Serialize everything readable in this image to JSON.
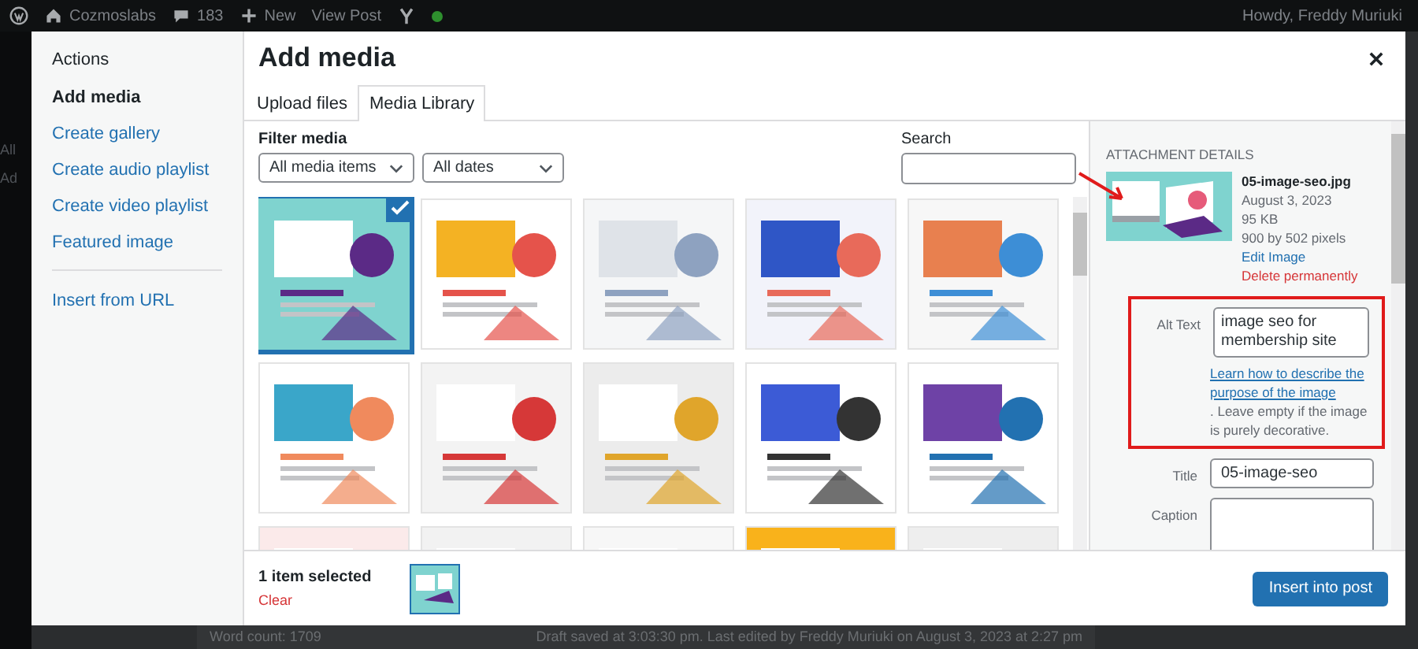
{
  "admin_bar": {
    "site": "Cozmoslabs",
    "comments": "183",
    "new": "New",
    "view_post": "View Post",
    "greeting": "Howdy, Freddy Muriuki"
  },
  "admin_menu": [
    "All",
    "Ad"
  ],
  "modal": {
    "title": "Add media",
    "sidebar": {
      "heading": "Actions",
      "items": [
        {
          "label": "Add media",
          "selected": true
        },
        {
          "label": "Create gallery",
          "selected": false
        },
        {
          "label": "Create audio playlist",
          "selected": false
        },
        {
          "label": "Create video playlist",
          "selected": false
        },
        {
          "label": "Featured image",
          "selected": false
        }
      ],
      "extra_items": [
        {
          "label": "Insert from URL",
          "selected": false
        }
      ]
    },
    "tabs": [
      {
        "label": "Upload files",
        "selected": false
      },
      {
        "label": "Media Library",
        "selected": true
      }
    ],
    "filter_label": "Filter media",
    "filters": [
      "All media items",
      "All dates"
    ],
    "search_label": "Search",
    "media_items": [
      {
        "kind": "picture",
        "selected": true
      },
      {
        "kind": "picture",
        "selected": false
      },
      {
        "kind": "picture",
        "selected": false
      },
      {
        "kind": "picture",
        "selected": false
      },
      {
        "kind": "picture",
        "selected": false
      },
      {
        "kind": "picture",
        "selected": false
      },
      {
        "kind": "picture",
        "selected": false
      },
      {
        "kind": "picture",
        "selected": false
      },
      {
        "kind": "picture",
        "selected": false
      },
      {
        "kind": "picture",
        "selected": false
      },
      {
        "kind": "picture",
        "selected": false
      },
      {
        "kind": "picture",
        "selected": false
      },
      {
        "kind": "picture",
        "selected": false
      },
      {
        "kind": "picture",
        "selected": false
      },
      {
        "kind": "picture",
        "selected": false
      }
    ],
    "details": {
      "heading": "ATTACHMENT DETAILS",
      "filename": "05-image-seo.jpg",
      "date": "August 3, 2023",
      "size": "95 KB",
      "dimensions": "900 by 502 pixels",
      "edit_link": "Edit Image",
      "delete_link": "Delete permanently",
      "alt_label": "Alt Text",
      "alt_value": "image seo for membership site",
      "alt_help_link": "Learn how to describe the purpose of the image",
      "alt_help": ". Leave empty if the image is purely decorative.",
      "title_label": "Title",
      "title_value": "05-image-seo",
      "caption_label": "Caption"
    },
    "selection": {
      "count": "1 item selected",
      "clear": "Clear"
    },
    "insert_button": "Insert into post"
  },
  "status": {
    "word_count": "Word count: 1709",
    "draft": "Draft saved at 3:03:30 pm. Last edited by Freddy Muriuki on August 3, 2023 at 2:27 pm"
  }
}
